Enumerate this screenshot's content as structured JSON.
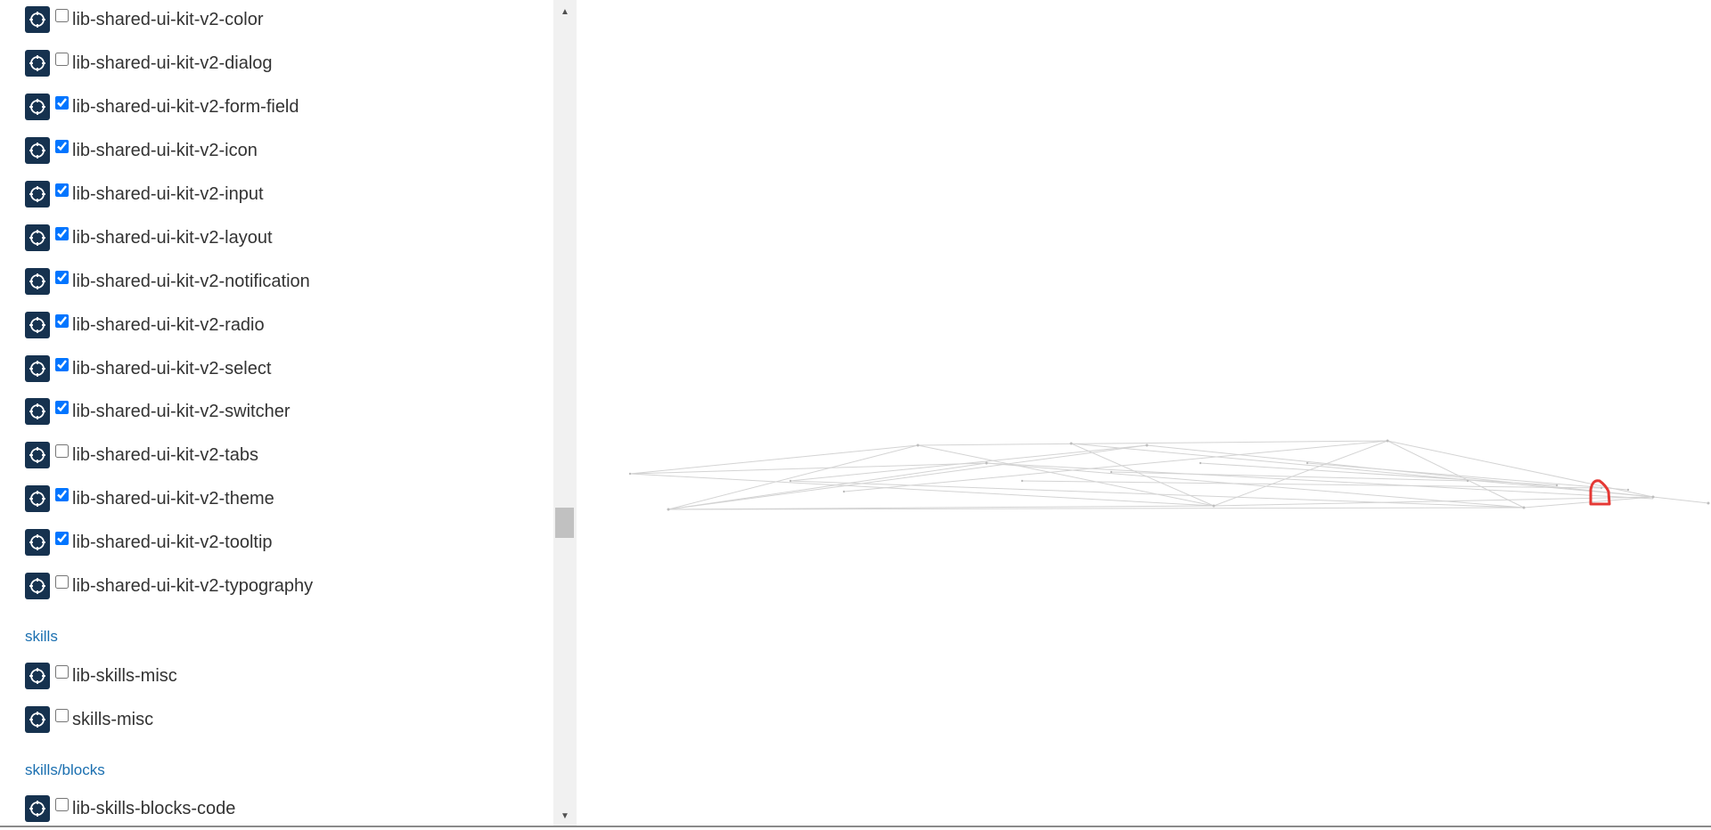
{
  "sidebar": {
    "groups": [
      {
        "title": "",
        "items": [
          {
            "label": "lib-shared-ui-kit-v2-color",
            "checked": false
          },
          {
            "label": "lib-shared-ui-kit-v2-dialog",
            "checked": false
          },
          {
            "label": "lib-shared-ui-kit-v2-form-field",
            "checked": true
          },
          {
            "label": "lib-shared-ui-kit-v2-icon",
            "checked": true
          },
          {
            "label": "lib-shared-ui-kit-v2-input",
            "checked": true
          },
          {
            "label": "lib-shared-ui-kit-v2-layout",
            "checked": true
          },
          {
            "label": "lib-shared-ui-kit-v2-notification",
            "checked": true
          },
          {
            "label": "lib-shared-ui-kit-v2-radio",
            "checked": true
          },
          {
            "label": "lib-shared-ui-kit-v2-select",
            "checked": true
          },
          {
            "label": "lib-shared-ui-kit-v2-switcher",
            "checked": true
          },
          {
            "label": "lib-shared-ui-kit-v2-tabs",
            "checked": false
          },
          {
            "label": "lib-shared-ui-kit-v2-theme",
            "checked": true
          },
          {
            "label": "lib-shared-ui-kit-v2-tooltip",
            "checked": true
          },
          {
            "label": "lib-shared-ui-kit-v2-typography",
            "checked": false
          }
        ]
      },
      {
        "title": "skills",
        "items": [
          {
            "label": "lib-skills-misc",
            "checked": false
          },
          {
            "label": "skills-misc",
            "checked": false
          }
        ]
      },
      {
        "title": "skills/blocks",
        "items": [
          {
            "label": "lib-skills-blocks-code",
            "checked": false
          }
        ]
      }
    ],
    "focus_icon": "crosshair-focus-icon"
  },
  "scrollbar": {
    "up_icon": "triangle-up-icon",
    "down_icon": "triangle-down-icon"
  },
  "colors": {
    "focus_button_bg": "#16324f",
    "group_header": "#1a6fb0",
    "highlight_ring": "#e53935",
    "graph_edge": "#cfcfcf"
  }
}
